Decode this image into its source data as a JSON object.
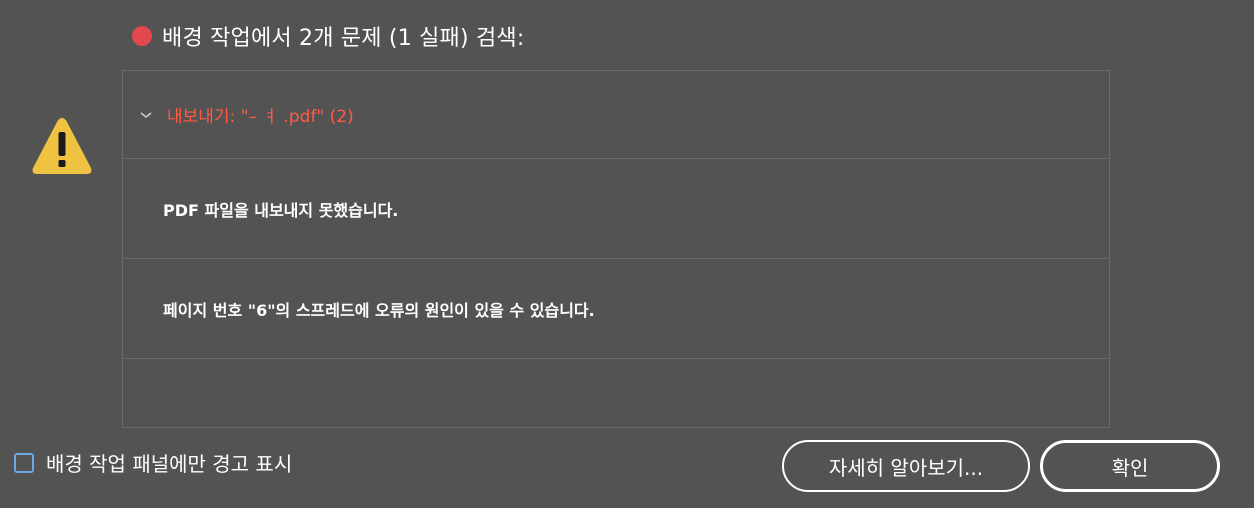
{
  "header": {
    "status_color": "#e34850",
    "title": "배경 작업에서 2개 문제 (1 실패)  검색:"
  },
  "warning": {
    "icon": "warning-triangle-icon",
    "color": "#f0c242"
  },
  "messages": {
    "group_label": "내보내기: \"– ㅕ .pdf\" (2)",
    "group_color": "#ff5a40",
    "items": [
      "PDF 파일을 내보내지 못했습니다.",
      "페이지 번호 \"6\"의 스프레드에 오류의 원인이 있을 수 있습니다."
    ]
  },
  "footer": {
    "checkbox_label": "배경 작업 패널에만 경고 표시",
    "checkbox_checked": false,
    "learn_more_label": "자세히 알아보기...",
    "ok_label": "확인"
  }
}
